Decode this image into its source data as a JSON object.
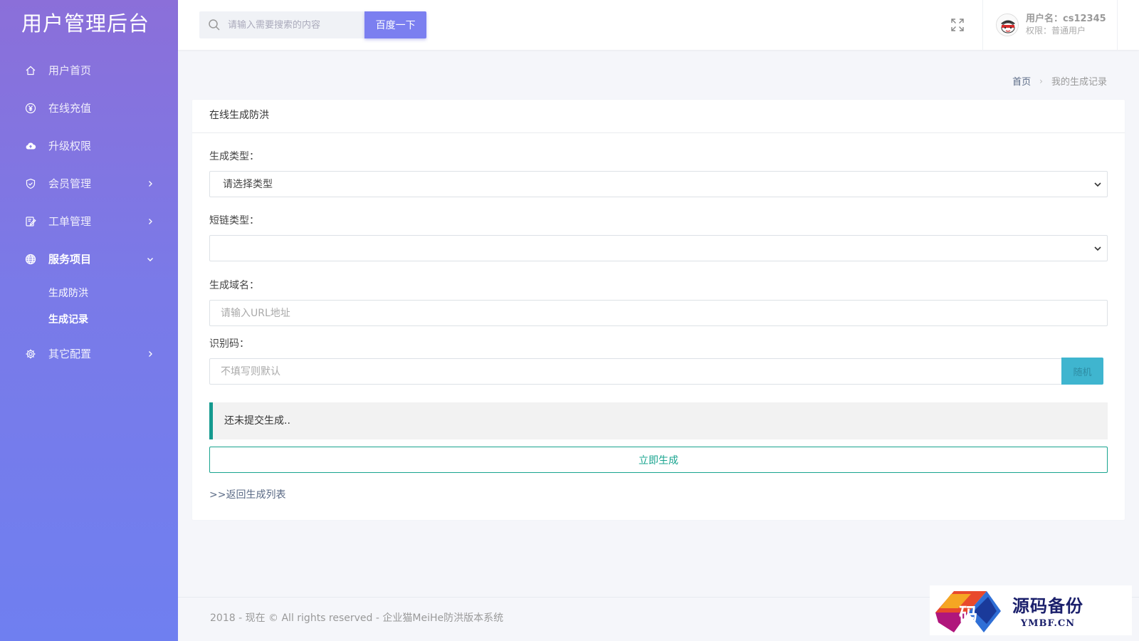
{
  "brand": {
    "title": "用户管理后台"
  },
  "sidebar": {
    "items": [
      {
        "label": "用户首页",
        "icon": "home-icon"
      },
      {
        "label": "在线充值",
        "icon": "yen-icon"
      },
      {
        "label": "升级权限",
        "icon": "cloud-upload-icon"
      },
      {
        "label": "会员管理",
        "icon": "shield-icon"
      },
      {
        "label": "工单管理",
        "icon": "edit-icon"
      },
      {
        "label": "服务项目",
        "icon": "globe-icon"
      },
      {
        "label": "其它配置",
        "icon": "gear-icon"
      }
    ],
    "sub_items": [
      {
        "label": "生成防洪"
      },
      {
        "label": "生成记录"
      }
    ]
  },
  "topbar": {
    "search_placeholder": "请输入需要搜索的内容",
    "search_button": "百度一下",
    "user_name": "用户名：cs12345",
    "user_role": "权限：普通用户"
  },
  "breadcrumb": {
    "home": "首页",
    "current": "我的生成记录"
  },
  "card": {
    "title": "在线生成防洪",
    "gen_type_label": "生成类型：",
    "gen_type_selected": "请选择类型",
    "link_type_label": "短链类型：",
    "link_type_selected": "",
    "domain_label": "生成域名：",
    "domain_placeholder": "请输入URL地址",
    "code_label": "识别码：",
    "code_placeholder": "不填写则默认",
    "random_button": "随机",
    "notice": "还未提交生成..",
    "generate_button": "立即生成",
    "back_link": ">>返回生成列表"
  },
  "footer": {
    "text": "2018 - 现在 © All rights reserved - 企业猫MeiHe防洪版本系统"
  },
  "watermark": {
    "cn": "源码备份",
    "en": "YMBF.CN",
    "logo_char": "码"
  },
  "colors": {
    "accent": "#7b7ff0",
    "success": "#18a48f",
    "info": "#3fb5cf"
  }
}
